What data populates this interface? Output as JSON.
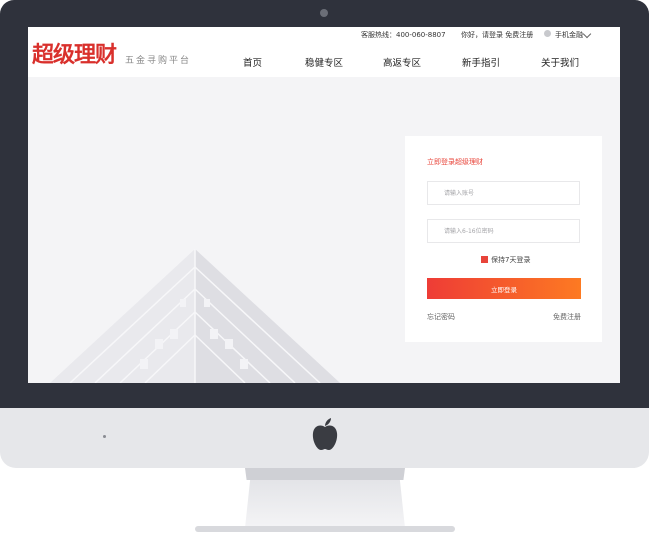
{
  "header": {
    "logo_text": "超级理财",
    "slogan": "五金寻购平台",
    "hotline": "客服热线：400-060-8807",
    "greeting": "你好，请登录 免费注册",
    "mobile": "手机金融"
  },
  "nav": {
    "items": [
      {
        "label": "首页"
      },
      {
        "label": "稳健专区"
      },
      {
        "label": "高返专区"
      },
      {
        "label": "新手指引"
      },
      {
        "label": "关于我们"
      }
    ]
  },
  "login": {
    "title": "立即登录超级理财",
    "account_placeholder": "请输入账号",
    "password_placeholder": "请输入6-16位密码",
    "remember_label": "保持7天登录",
    "remember_checked": true,
    "submit_label": "立即登录",
    "forgot_label": "忘记密码",
    "register_label": "免费注册"
  },
  "colors": {
    "brand": "#d9302c",
    "accent": "#e8443a",
    "button_start": "#ee3c36",
    "button_end": "#fd7a22",
    "bezel": "#2f323c"
  },
  "icons": [
    "camera",
    "chevron-down-icon",
    "phone-icon",
    "apple-logo-icon",
    "checkbox-icon"
  ]
}
